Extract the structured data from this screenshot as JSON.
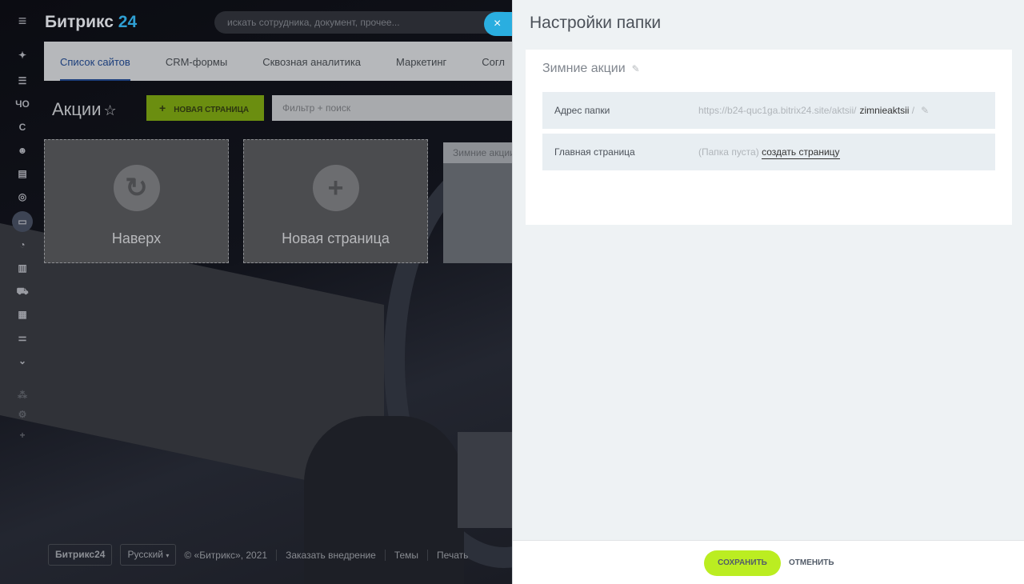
{
  "header": {
    "logo_text": "Битрикс",
    "logo_number": "24",
    "search_placeholder": "искать сотрудника, документ, прочее..."
  },
  "leftbar": {
    "items": [
      "chat-icon",
      "filter-icon",
      "ЧО",
      "С",
      "robot-icon",
      "book-icon",
      "target-icon",
      "sites-icon",
      "clock-icon",
      "chart-icon",
      "cart-icon",
      "apps-icon",
      "settings-sliders-icon",
      "chevron-down-icon",
      "sitemap-icon",
      "gear-icon",
      "plus-icon"
    ]
  },
  "tabs": [
    {
      "label": "Список сайтов",
      "active": true
    },
    {
      "label": "CRM-формы"
    },
    {
      "label": "Сквозная аналитика"
    },
    {
      "label": "Маркетинг"
    },
    {
      "label": "Согл"
    }
  ],
  "page": {
    "title": "Акции",
    "new_page_button": "НОВАЯ СТРАНИЦА",
    "filter_placeholder": "Фильтр + поиск"
  },
  "tiles": [
    {
      "label": "Наверх",
      "icon": "folder-up-icon"
    },
    {
      "label": "Новая страница",
      "icon": "plus-icon"
    },
    {
      "label": "Зимние акции"
    }
  ],
  "footer": {
    "brand": "Битрикс24",
    "language": "Русский",
    "copyright": "© «Битрикс», 2021",
    "links": [
      "Заказать внедрение",
      "Темы",
      "Печать"
    ]
  },
  "panel": {
    "title": "Настройки папки",
    "folder_name": "Зимние акции",
    "rows": [
      {
        "label": "Адрес папки",
        "url_prefix": "https://b24-quc1ga.bitrix24.site/aktsii/",
        "slug": "zimnieaktsii",
        "suffix": "/"
      },
      {
        "label": "Главная страница",
        "empty_text": "(Папка пуста)",
        "link": "создать страницу"
      }
    ],
    "save": "СОХРАНИТЬ",
    "cancel": "ОТМЕНИТЬ"
  },
  "colors": {
    "accent_green": "#bbed21",
    "close_blue": "#2aaee0",
    "active_tab": "#1d3f7c"
  }
}
